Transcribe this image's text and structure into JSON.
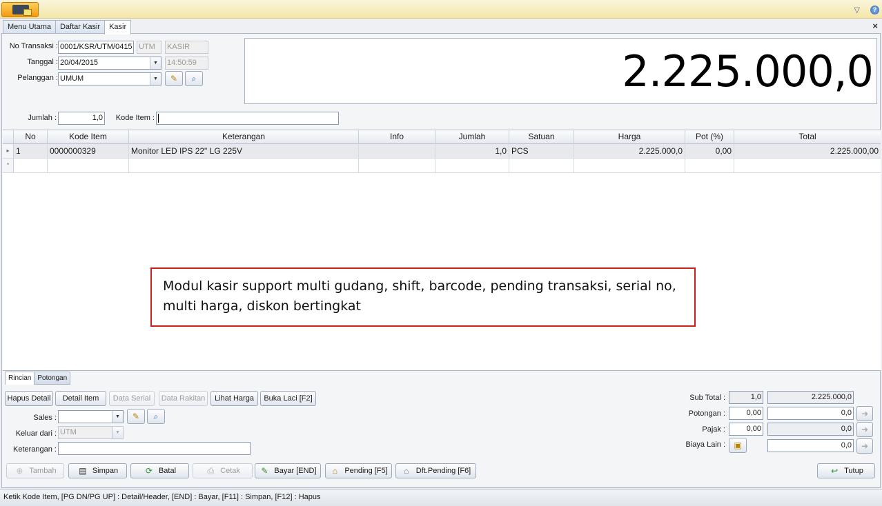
{
  "window": {
    "app_icon": "app-logo-icon",
    "min_icon": "chevron-down-icon",
    "help_icon": "help-icon",
    "help_glyph": "?"
  },
  "tabs": [
    {
      "label": "Menu Utama"
    },
    {
      "label": "Daftar Kasir"
    },
    {
      "label": "Kasir"
    }
  ],
  "close_glyph": "×",
  "header": {
    "no_transaksi_label": "No Transaksi :",
    "no_transaksi_value": "0001/KSR/UTM/0415",
    "gudang_value": "UTM",
    "user_value": "KASIR",
    "tanggal_label": "Tanggal :",
    "tanggal_value": "20/04/2015",
    "jam_value": "14:50:59",
    "pelanggan_label": "Pelanggan :",
    "pelanggan_value": "UMUM"
  },
  "total_display": "2.225.000,0",
  "entry": {
    "jumlah_label": "Jumlah :",
    "jumlah_value": "1,0",
    "kode_item_label": "Kode Item :",
    "kode_item_value": ""
  },
  "grid": {
    "columns": [
      "No",
      "Kode Item",
      "Keterangan",
      "Info",
      "Jumlah",
      "Satuan",
      "Harga",
      "Pot (%)",
      "Total"
    ],
    "rows": [
      {
        "no": "1",
        "kode_item": "0000000329",
        "keterangan": "Monitor LED IPS 22\" LG 225V",
        "info": "",
        "jumlah": "1,0",
        "satuan": "PCS",
        "harga": "2.225.000,0",
        "pot": "0,00",
        "total": "2.225.000,00"
      }
    ],
    "new_row_marker": "*"
  },
  "callout": "Modul kasir support multi gudang, shift, barcode, pending transaksi, serial no, multi harga, diskon bertingkat",
  "subtabs": [
    {
      "label": "Rincian"
    },
    {
      "label": "Potongan"
    }
  ],
  "actions": {
    "hapus_detail": "Hapus Detail",
    "detail_item": "Detail Item",
    "data_serial": "Data Serial",
    "data_rakitan": "Data Rakitan",
    "lihat_harga": "Lihat Harga",
    "buka_laci": "Buka Laci [F2]"
  },
  "footer_form": {
    "sales_label": "Sales :",
    "sales_value": "",
    "keluar_dari_label": "Keluar dari :",
    "keluar_dari_value": "UTM",
    "keterangan_label": "Keterangan :",
    "keterangan_value": ""
  },
  "summary": {
    "sub_total_label": "Sub Total :",
    "sub_total_qty": "1,0",
    "sub_total_value": "2.225.000,0",
    "potongan_label": "Potongan :",
    "potongan_pct": "0,00",
    "potongan_value": "0,0",
    "pajak_label": "Pajak :",
    "pajak_pct": "0,00",
    "pajak_value": "0,0",
    "biaya_lain_label": "Biaya Lain :",
    "biaya_lain_value": "0,0"
  },
  "bottom_buttons": {
    "tambah": "Tambah",
    "simpan": "Simpan",
    "batal": "Batal",
    "cetak": "Cetak",
    "bayar": "Bayar [END]",
    "pending": "Pending [F5]",
    "dft_pending": "Dft.Pending [F6]",
    "tutup": "Tutup"
  },
  "status_bar": "Ketik Kode Item, [PG DN/PG UP] : Detail/Header, [END] : Bayar, [F11] : Simpan, [F12] : Hapus"
}
